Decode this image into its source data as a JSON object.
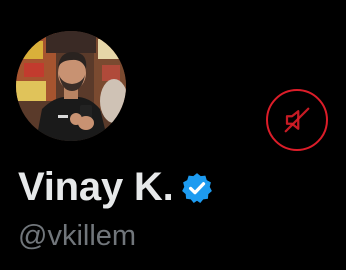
{
  "profile": {
    "display_name": "Vinay K.",
    "handle": "@vkillem",
    "verified": true,
    "verified_icon": "verified-badge-icon",
    "avatar_alt": "profile photo"
  },
  "actions": {
    "mute_icon": "muted-speaker-icon"
  },
  "colors": {
    "background": "#000000",
    "name": "#e7e9ea",
    "handle": "#71767b",
    "verified": "#1d9bf0",
    "mute_accent": "#f4212e"
  }
}
